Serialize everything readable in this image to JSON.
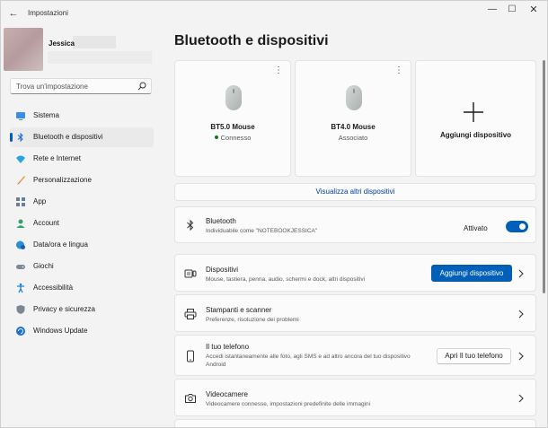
{
  "window": {
    "title": "Impostazioni",
    "back_glyph": "←",
    "minimize_glyph": "—",
    "maximize_glyph": "☐",
    "close_glyph": "✕"
  },
  "profile": {
    "name": "Jessica"
  },
  "search": {
    "placeholder": "Trova un'impostazione"
  },
  "sidebar": {
    "items": [
      {
        "label": "Sistema",
        "icon": "monitor-icon",
        "active": false
      },
      {
        "label": "Bluetooth e dispositivi",
        "icon": "bluetooth-icon",
        "active": true
      },
      {
        "label": "Rete e Internet",
        "icon": "wifi-icon",
        "active": false
      },
      {
        "label": "Personalizzazione",
        "icon": "brush-icon",
        "active": false
      },
      {
        "label": "App",
        "icon": "apps-icon",
        "active": false
      },
      {
        "label": "Account",
        "icon": "person-icon",
        "active": false
      },
      {
        "label": "Data/ora e lingua",
        "icon": "globe-clock-icon",
        "active": false
      },
      {
        "label": "Giochi",
        "icon": "gamepad-icon",
        "active": false
      },
      {
        "label": "Accessibilità",
        "icon": "accessibility-icon",
        "active": false
      },
      {
        "label": "Privacy e sicurezza",
        "icon": "shield-icon",
        "active": false
      },
      {
        "label": "Windows Update",
        "icon": "update-icon",
        "active": false
      }
    ]
  },
  "main": {
    "title": "Bluetooth e dispositivi",
    "devices": [
      {
        "name": "BT5.0 Mouse",
        "status": "Connesso",
        "connected": true
      },
      {
        "name": "BT4.0 Mouse",
        "status": "Associato",
        "connected": false
      }
    ],
    "more_glyph": "⋮",
    "add_device_card_label": "Aggiungi dispositivo",
    "show_more_label": "Visualizza altri dispositivi",
    "bluetooth": {
      "title": "Bluetooth",
      "subtitle": "Individuabile come \"NOTEBOOKJESSICA\"",
      "toggle_label": "Attivato",
      "enabled": true
    },
    "rows": [
      {
        "title": "Dispositivi",
        "subtitle": "Mouse, tastiera, penna, audio, schermi e dock, altri dispositivi",
        "button": "Aggiungi dispositivo"
      },
      {
        "title": "Stampanti e scanner",
        "subtitle": "Preferenze, risoluzione dei problemi"
      },
      {
        "title": "Il tuo telefono",
        "subtitle": "Accedi istantaneamente alle foto, agli SMS e ad altro ancora del tuo dispositivo Android",
        "button": "Apri Il tuo telefono"
      },
      {
        "title": "Videocamere",
        "subtitle": "Videocamere connesse, impostazioni predefinite delle immagini"
      }
    ]
  },
  "colors": {
    "accent": "#005fb8",
    "connected": "#0f7b0f",
    "card_bg": "#fbfbfb",
    "window_bg": "#f3f3f3"
  }
}
